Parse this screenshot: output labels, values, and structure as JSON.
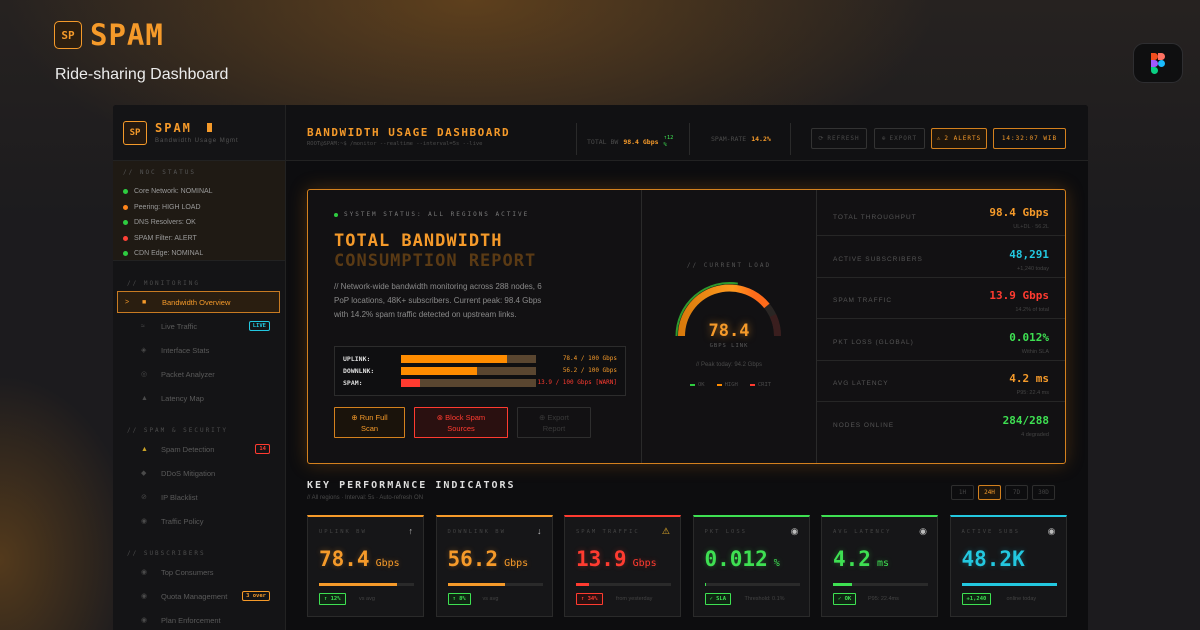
{
  "brand": {
    "logo": "SP",
    "name": "SPAM",
    "tagline": "Ride-sharing Dashboard"
  },
  "sidebar": {
    "logo": "SP",
    "title": "SPAM",
    "subtitle": "Bandwidth Usage Mgmt",
    "noc_label": "// NOC STATUS",
    "noc": [
      {
        "label": "Core Network: NOMINAL",
        "color": "#2ecc40"
      },
      {
        "label": "Peering: HIGH LOAD",
        "color": "#ff851b"
      },
      {
        "label": "DNS Resolvers: OK",
        "color": "#2ecc40"
      },
      {
        "label": "SPAM Filter: ALERT",
        "color": "#ff4136"
      },
      {
        "label": "CDN Edge: NOMINAL",
        "color": "#2ecc40"
      }
    ],
    "sections": {
      "monitoring": "// MONITORING",
      "security": "// SPAM & SECURITY",
      "subscribers": "// SUBSCRIBERS"
    },
    "items": [
      {
        "label": "Bandwidth Overview",
        "icon": "grid-icon"
      },
      {
        "label": "Live Traffic",
        "icon": "wave-icon",
        "tag": "LIVE"
      },
      {
        "label": "Interface Stats",
        "icon": "interface-icon"
      },
      {
        "label": "Packet Analyzer",
        "icon": "packet-icon"
      },
      {
        "label": "Latency Map",
        "icon": "map-icon"
      },
      {
        "label": "Spam Detection",
        "icon": "warning-icon",
        "tag": "14"
      },
      {
        "label": "DDoS Mitigation",
        "icon": "shield-icon"
      },
      {
        "label": "IP Blacklist",
        "icon": "block-icon"
      },
      {
        "label": "Traffic Policy",
        "icon": "policy-icon"
      },
      {
        "label": "Top Consumers",
        "icon": "users-icon"
      },
      {
        "label": "Quota Management",
        "icon": "quota-icon",
        "tag": "3 over"
      },
      {
        "label": "Plan Enforcement",
        "icon": "plan-icon"
      }
    ]
  },
  "topbar": {
    "title": "BANDWIDTH USAGE DASHBOARD",
    "path": "ROOT@SPAM:~$ /monitor --realtime --interval=5s --live",
    "total_bw_label": "TOTAL BW",
    "total_bw": "98.4 Gbps",
    "total_bw_delta": "↑12 %",
    "spam_rate_label": "SPAM-RATE",
    "spam_rate": "14.2%",
    "refresh": "REFRESH",
    "export": "EXPORT",
    "alerts": "2 ALERTS",
    "clock": "14:32:07 WIB"
  },
  "hero": {
    "status": "SYSTEM STATUS: ALL REGIONS ACTIVE",
    "title1": "TOTAL BANDWIDTH",
    "title2": "CONSUMPTION REPORT",
    "desc": "// Network-wide bandwidth monitoring across 288 nodes, 6 PoP locations, 48K+ subscribers. Current peak: 98.4 Gbps with 14.2% spam traffic detected on upstream links.",
    "bars": [
      {
        "label": "UPLINK:",
        "value": "78.4 / 100 Gbps",
        "frac": 0.784,
        "color": "#ff8c00",
        "vcolor": "#f59a2a"
      },
      {
        "label": "DOWNLNK:",
        "value": "56.2 / 100 Gbps",
        "frac": 0.562,
        "color": "#ff8c00",
        "vcolor": "#f59a2a"
      },
      {
        "label": "SPAM:",
        "value": "13.9 / 100 Gbps [WARN]",
        "frac": 0.139,
        "color": "#ff3b30",
        "vcolor": "#ff3b30"
      }
    ],
    "actions": {
      "run": "⊕ Run Full Scan",
      "block": "⊗ Block Spam Sources",
      "export": "⊕ Export Report"
    },
    "gauge": {
      "label": "// CURRENT LOAD",
      "value": "78.4",
      "unit": "GBPS LINK",
      "peak": "// Peak today: 94.2 Gbps",
      "legend": [
        "OK",
        "HIGH",
        "CRIT"
      ],
      "frac": 0.784
    }
  },
  "metrics": [
    {
      "label": "TOTAL THROUGHPUT",
      "value": "98.4 Gbps",
      "sub": "UL+DL · 56.2L",
      "color": "#f59a2a"
    },
    {
      "label": "ACTIVE SUBSCRIBERS",
      "value": "48,291",
      "sub": "+1,240 today",
      "color": "#23c8e0"
    },
    {
      "label": "SPAM TRAFFIC",
      "value": "13.9 Gbps",
      "sub": "14.2% of total",
      "color": "#ff3b30"
    },
    {
      "label": "PKT LOSS (GLOBAL)",
      "value": "0.012%",
      "sub": "Within SLA",
      "color": "#3ee052"
    },
    {
      "label": "AVG LATENCY",
      "value": "4.2 ms",
      "sub": "P95: 22.4 ms",
      "color": "#f59a2a"
    },
    {
      "label": "NODES ONLINE",
      "value": "284/288",
      "sub": "4 degraded",
      "color": "#3ee052"
    }
  ],
  "kpi": {
    "title": "KEY PERFORMANCE INDICATORS",
    "sub": "// All regions · Interval: 5s · Auto-refresh ON",
    "ranges": [
      "1H",
      "24H",
      "7D",
      "30D"
    ],
    "cards": [
      {
        "label": "UPLINK BW",
        "value": "78.4",
        "unit": "Gbps",
        "icon": "↑",
        "color": "#f59a2a",
        "bar": 0.82,
        "badge": "↑ 12%",
        "note": "vs avg",
        "bcolor": "#3ee052"
      },
      {
        "label": "DOWNLINK BW",
        "value": "56.2",
        "unit": "Gbps",
        "icon": "↓",
        "color": "#f59a2a",
        "bar": 0.6,
        "badge": "↑ 8%",
        "note": "vs avg",
        "bcolor": "#3ee052"
      },
      {
        "label": "SPAM TRAFFIC",
        "value": "13.9",
        "unit": "Gbps",
        "icon": "⚠",
        "color": "#ff3b30",
        "bar": 0.14,
        "badge": "↑ 34%",
        "note": "from yesterday",
        "bcolor": "#ff3b30"
      },
      {
        "label": "PKT LOSS",
        "value": "0.012",
        "unit": "%",
        "icon": "◉",
        "color": "#3ee052",
        "bar": 0.02,
        "badge": "✓ SLA",
        "note": "Threshold: 0.1%",
        "bcolor": "#3ee052"
      },
      {
        "label": "AVG LATENCY",
        "value": "4.2",
        "unit": "ms",
        "icon": "◉",
        "color": "#3ee052",
        "bar": 0.2,
        "badge": "✓ OK",
        "note": "P95: 22.4ms",
        "bcolor": "#3ee052"
      },
      {
        "label": "ACTIVE SUBS",
        "value": "48.2K",
        "unit": "",
        "icon": "◉",
        "color": "#23c8e0",
        "bar": 1.0,
        "badge": "+1,240",
        "note": "online today",
        "bcolor": "#3ee052"
      }
    ]
  }
}
